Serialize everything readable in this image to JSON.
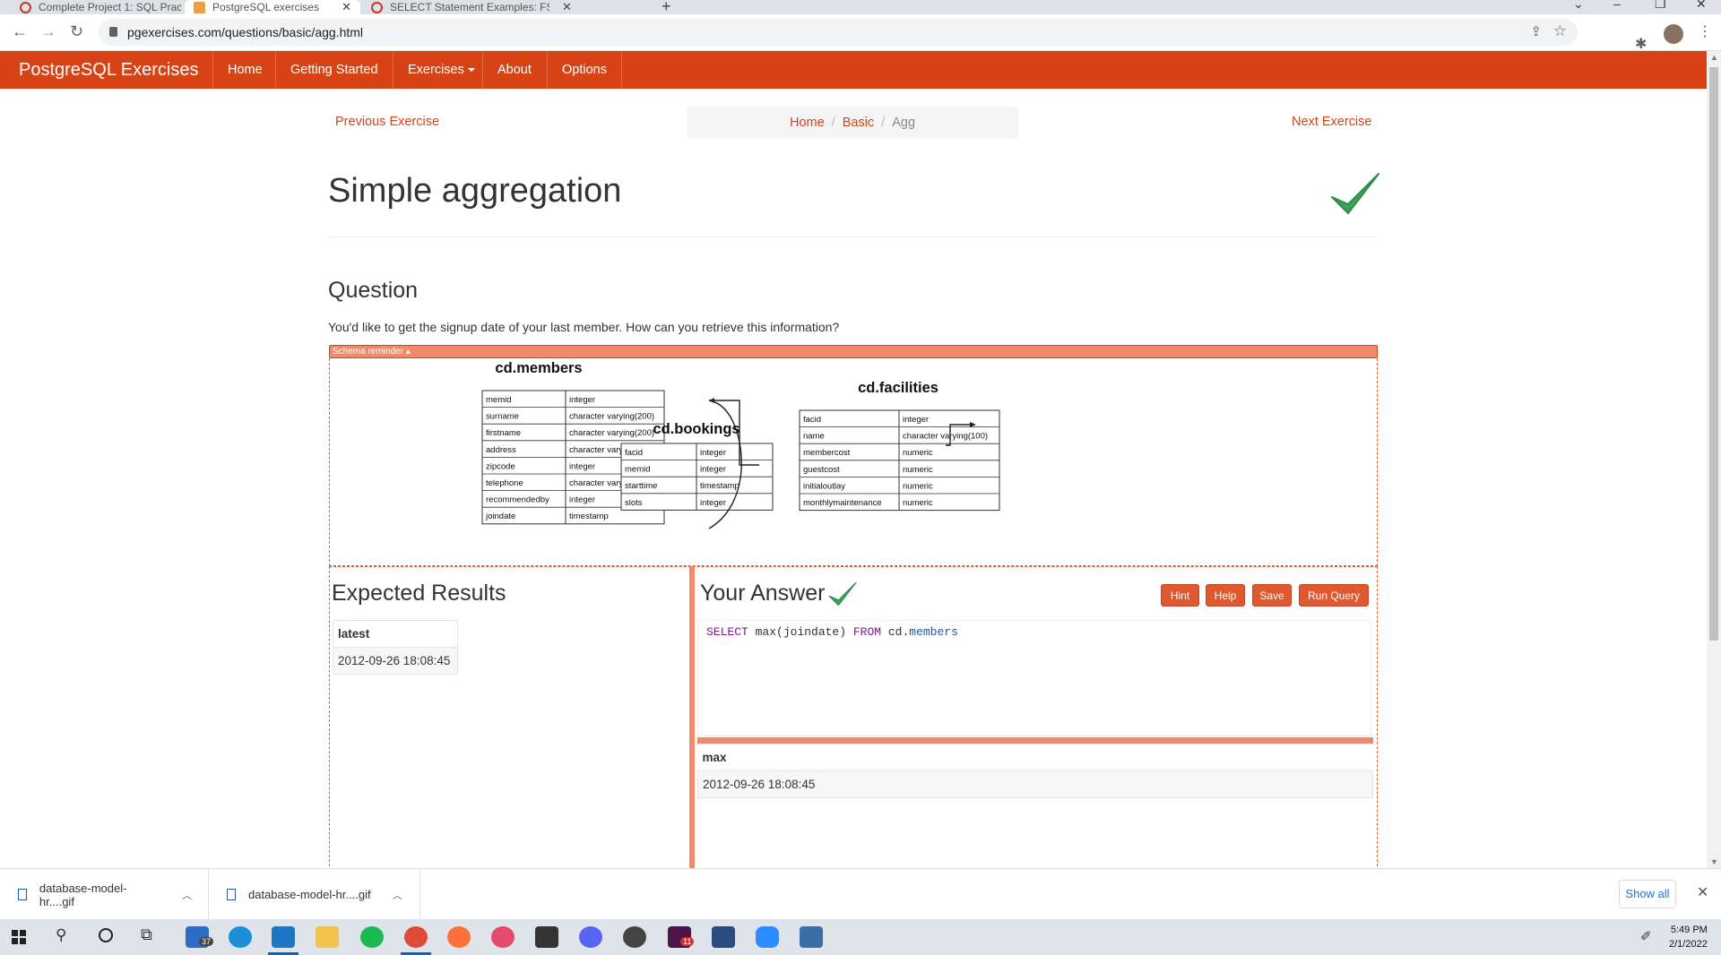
{
  "browser": {
    "tabs": [
      {
        "title": "Complete Project 1: SQL Practice",
        "active": false
      },
      {
        "title": "PostgreSQL exercises",
        "active": true
      },
      {
        "title": "SELECT Statement Examples: FSW",
        "active": false
      }
    ],
    "url": "pgexercises.com/questions/basic/agg.html"
  },
  "navbar": {
    "brand": "PostgreSQL Exercises",
    "items": [
      "Home",
      "Getting Started",
      "Exercises",
      "About",
      "Options"
    ]
  },
  "pager": {
    "previous": "Previous Exercise",
    "next": "Next Exercise"
  },
  "breadcrumb": [
    "Home",
    "Basic",
    "Agg"
  ],
  "page": {
    "title": "Simple aggregation",
    "question_heading": "Question",
    "question_text": "You'd like to get the signup date of your last member. How can you retrieve this information?",
    "schema_toggle": "Schema reminder ▴"
  },
  "schema": {
    "members": {
      "name": "cd.members",
      "columns": [
        [
          "memid",
          "integer"
        ],
        [
          "surname",
          "character varying(200)"
        ],
        [
          "firstname",
          "character varying(200)"
        ],
        [
          "address",
          "character varying(300)"
        ],
        [
          "zipcode",
          "integer"
        ],
        [
          "telephone",
          "character varying(20)"
        ],
        [
          "recommendedby",
          "integer"
        ],
        [
          "joindate",
          "timestamp"
        ]
      ]
    },
    "bookings": {
      "name": "cd.bookings",
      "columns": [
        [
          "facid",
          "integer"
        ],
        [
          "memid",
          "integer"
        ],
        [
          "starttime",
          "timestamp"
        ],
        [
          "slots",
          "integer"
        ]
      ]
    },
    "facilities": {
      "name": "cd.facilities",
      "columns": [
        [
          "facid",
          "integer"
        ],
        [
          "name",
          "character varying(100)"
        ],
        [
          "membercost",
          "numeric"
        ],
        [
          "guestcost",
          "numeric"
        ],
        [
          "initialoutlay",
          "numeric"
        ],
        [
          "monthlymaintenance",
          "numeric"
        ]
      ]
    }
  },
  "expected": {
    "heading": "Expected Results",
    "column": "latest",
    "value": "2012-09-26 18:08:45"
  },
  "answer": {
    "heading": "Your Answer",
    "buttons": {
      "hint": "Hint",
      "help": "Help",
      "save": "Save",
      "run": "Run Query"
    },
    "result_column": "max",
    "result_value": "2012-09-26 18:08:45"
  },
  "downloads": {
    "items": [
      "database-model-hr....gif",
      "database-model-hr....gif"
    ],
    "show_all": "Show all"
  },
  "taskbar": {
    "mail_badge": "37",
    "slack_badge": "11",
    "time": "5:49 PM",
    "date": "2/1/2022"
  },
  "colors": {
    "brand": "#d84315",
    "accent_light": "#f08a68",
    "success": "#3aa55a"
  }
}
